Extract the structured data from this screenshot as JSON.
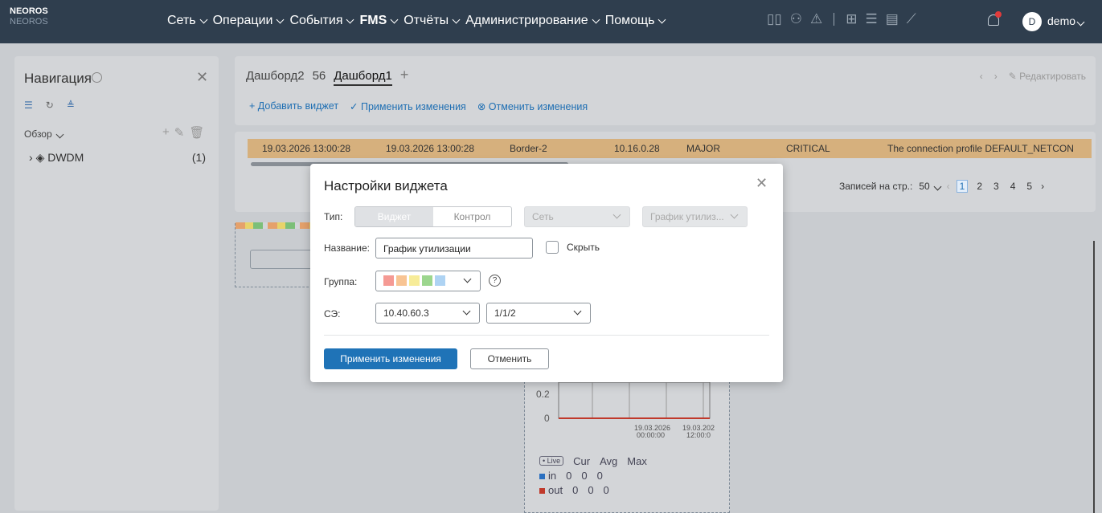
{
  "brand": {
    "name": "NEOROS",
    "sub": "NEOROS"
  },
  "menu": [
    "Сеть",
    "Операции",
    "События",
    "FMS",
    "Отчёты",
    "Администрирование",
    "Помощь"
  ],
  "user": {
    "initial": "D",
    "name": "demo"
  },
  "nav": {
    "title": "Навигация",
    "overview": "Обзор",
    "tree_item": {
      "label": "DWDM",
      "count": "(1)"
    }
  },
  "dashboard": {
    "tabs": [
      "Дашборд2",
      "56",
      "Дашборд1",
      "+"
    ],
    "edit_label": "Редактировать",
    "toolbar": {
      "add": "Добавить виджет",
      "apply": "Применить изменения",
      "cancel": "Отменить изменения"
    }
  },
  "table": {
    "row": [
      "19.03.2026 13:00:28",
      "19.03.2026 13:00:28",
      "Border-2",
      "10.16.0.28",
      "MAJOR",
      "CRITICAL",
      "The connection profile DEFAULT_NETCON"
    ],
    "pager": {
      "label": "Записей на стр.:",
      "per_page": "50",
      "pages": [
        "1",
        "2",
        "3",
        "4",
        "5"
      ],
      "current": "1"
    }
  },
  "chart_widget": {
    "y_ticks": [
      "0.2",
      "0"
    ],
    "x_ticks": [
      [
        "19.03.2026",
        "00:00:00"
      ],
      [
        "19.03.202",
        "12:00:0"
      ]
    ],
    "live_label": "• Live",
    "columns": [
      "Cur",
      "Avg",
      "Max"
    ],
    "series": [
      {
        "name": "in",
        "values": [
          "0",
          "0",
          "0"
        ],
        "color": "#2a6fc0"
      },
      {
        "name": "out",
        "values": [
          "0",
          "0",
          "0"
        ],
        "color": "#c0392b"
      }
    ]
  },
  "modal": {
    "title": "Настройки виджета",
    "type_label": "Тип:",
    "type_options": [
      "Виджет",
      "Контрол"
    ],
    "category": "Сеть",
    "widget_kind": "График утилиз...",
    "name_label": "Название:",
    "name_value": "График утилизации",
    "hide_label": "Скрыть",
    "group_label": "Группа:",
    "group_colors": [
      "#f59a94",
      "#f8c493",
      "#f7ec98",
      "#9cd68e",
      "#aed3f3"
    ],
    "ne_label": "СЭ:",
    "ne_value": "10.40.60.3",
    "port_value": "1/1/2",
    "apply_button": "Применить изменения",
    "cancel_button": "Отменить"
  }
}
